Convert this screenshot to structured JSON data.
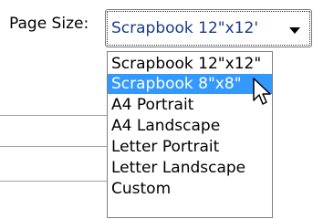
{
  "page_size": {
    "label": "Page Size:",
    "selected_value": "Scrapbook 12\"x12'",
    "options": [
      "Scrapbook 12\"x12\"",
      "Scrapbook 8\"x8\"",
      "A4 Portrait",
      "A4 Landscape",
      "Letter Portrait",
      "Letter Landscape",
      "Custom"
    ],
    "highlighted_option": "Scrapbook 8\"x8\""
  },
  "icons": {
    "dropdown_arrow": "chevron-down-icon",
    "cursor": "mouse-pointer-icon"
  },
  "colors": {
    "highlight": "#3399ff",
    "selected_text": "#1a3d8a"
  }
}
